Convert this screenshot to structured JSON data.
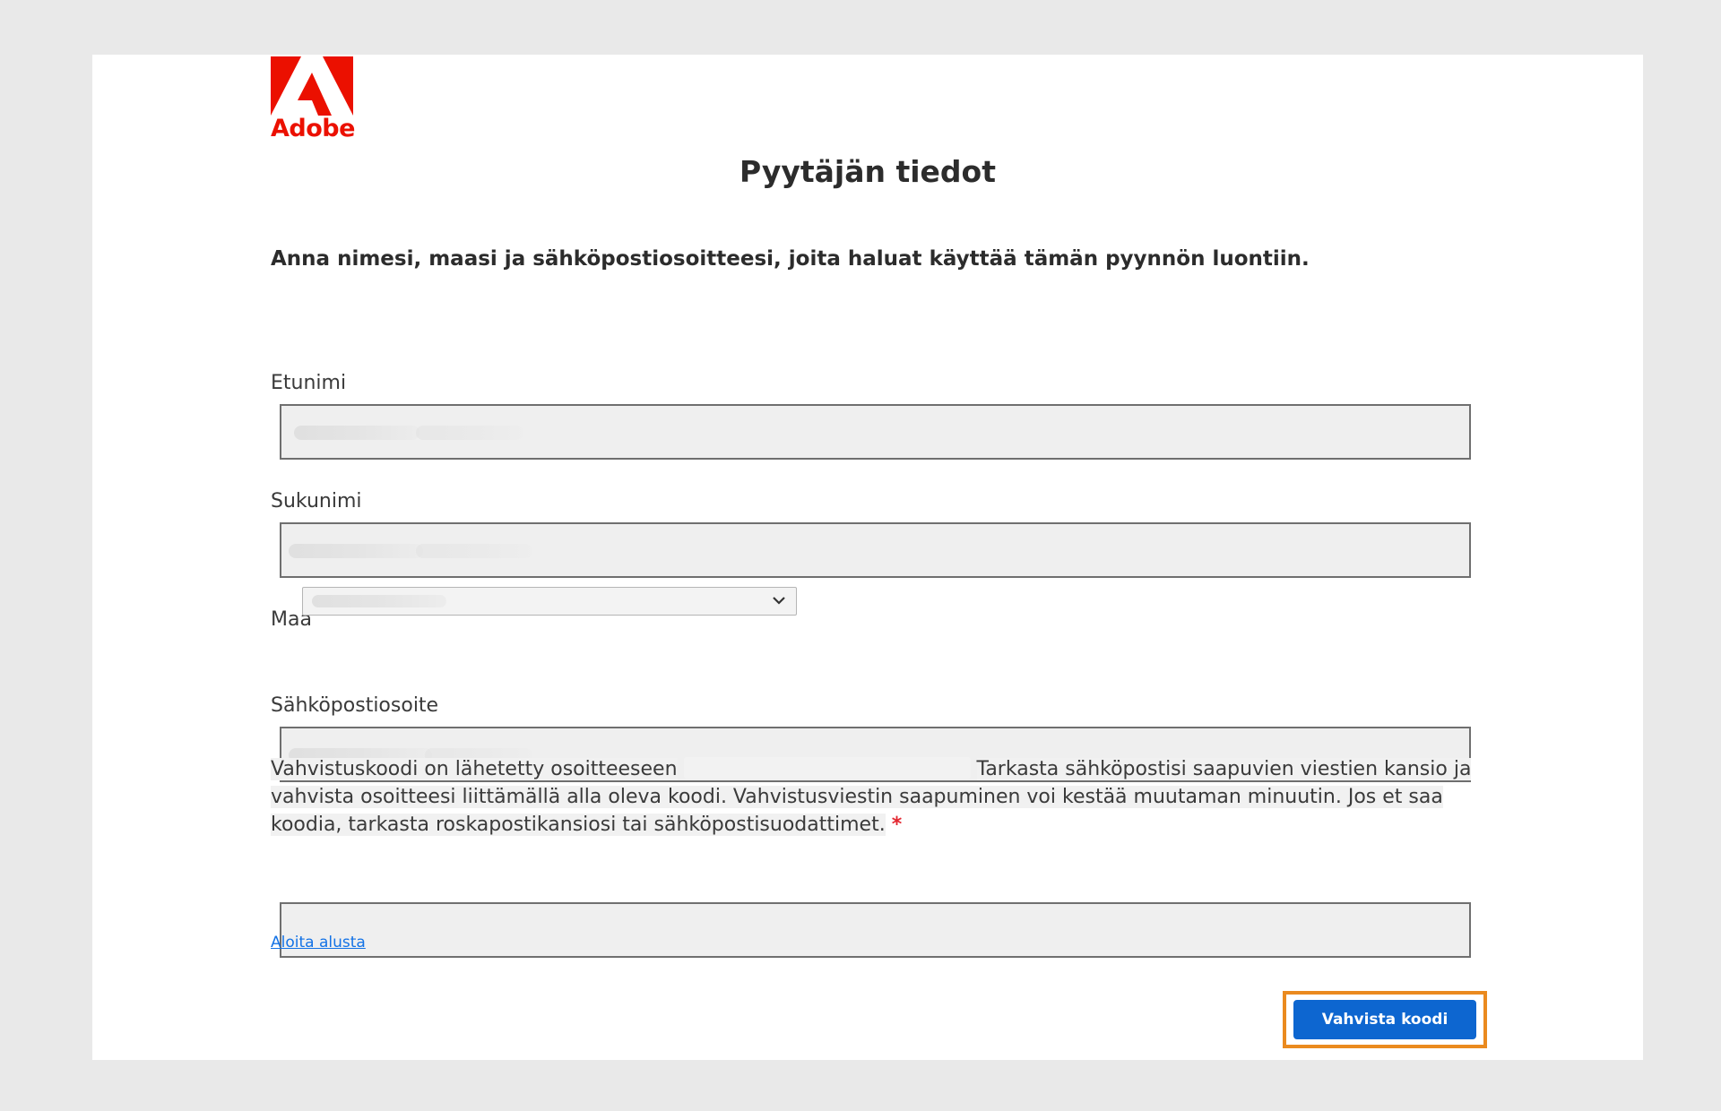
{
  "brand": {
    "name": "Adobe",
    "color": "#eb1000"
  },
  "page": {
    "title": "Pyytäjän tiedot",
    "intro": "Anna nimesi, maasi ja sähköpostiosoitteesi, joita haluat käyttää tämän pyynnön luontiin."
  },
  "form": {
    "first_name": {
      "label": "Etunimi",
      "value": ""
    },
    "last_name": {
      "label": "Sukunimi",
      "value": ""
    },
    "country": {
      "label": "Maa",
      "selected": ""
    },
    "email": {
      "label": "Sähköpostiosoite",
      "value": ""
    },
    "verification": {
      "text_before": "Vahvistuskoodi on lähetetty osoitteeseen",
      "text_after": "Tarkasta sähköpostisi saapuvien viestien kansio ja vahvista osoitteesi liittämällä alla oleva koodi. Vahvistusviestin saapuminen voi kestää muutaman minuutin. Jos et saa koodia, tarkasta roskapostikansiosi tai sähköpostisuodattimet.",
      "required_marker": "*",
      "code_value": ""
    }
  },
  "actions": {
    "restart_link": "Aloita alusta",
    "verify_button": "Vahvista koodi",
    "highlight_color": "#ea8a1f",
    "button_color": "#0d66d0"
  }
}
